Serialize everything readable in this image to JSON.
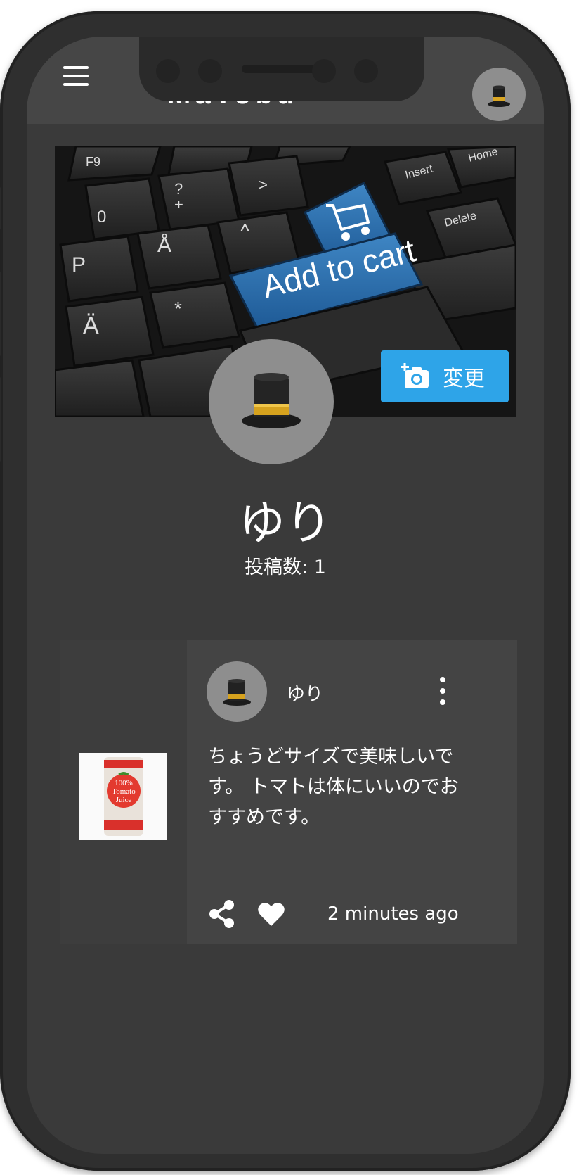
{
  "app": {
    "brand_text": "MaTobu"
  },
  "cover": {
    "key_add_to_cart": "Add to cart",
    "key_insert": "Insert",
    "key_home": "Home",
    "key_delete": "Delete",
    "key_p": "P",
    "key_a_umlaut_1": "Å",
    "key_a_umlaut_2": "Ä",
    "key_question": "?",
    "key_plus": "+",
    "key_zero": "0",
    "key_f9": "F9",
    "change_button_label": "変更"
  },
  "profile": {
    "name": "ゆり",
    "post_count_label": "投稿数: 1",
    "avatar_icon": "top-hat-emoji"
  },
  "post": {
    "author": "ゆり",
    "text": "ちょうどサイズで美味しいです。 トマトは体にいいのでおすすめです。",
    "timestamp": "2 minutes ago",
    "image_label_pct": "100%",
    "image_label_tomato": "Tomato",
    "image_label_juice": "Juice"
  },
  "icons": {
    "menu": "hamburger-menu-icon",
    "camera": "add-photo-icon",
    "more": "more-vert-icon",
    "share": "share-icon",
    "like": "heart-icon"
  },
  "colors": {
    "accent": "#2ea4e8",
    "app_bar": "#464646",
    "background": "#3a3a3a",
    "card": "#444444"
  }
}
